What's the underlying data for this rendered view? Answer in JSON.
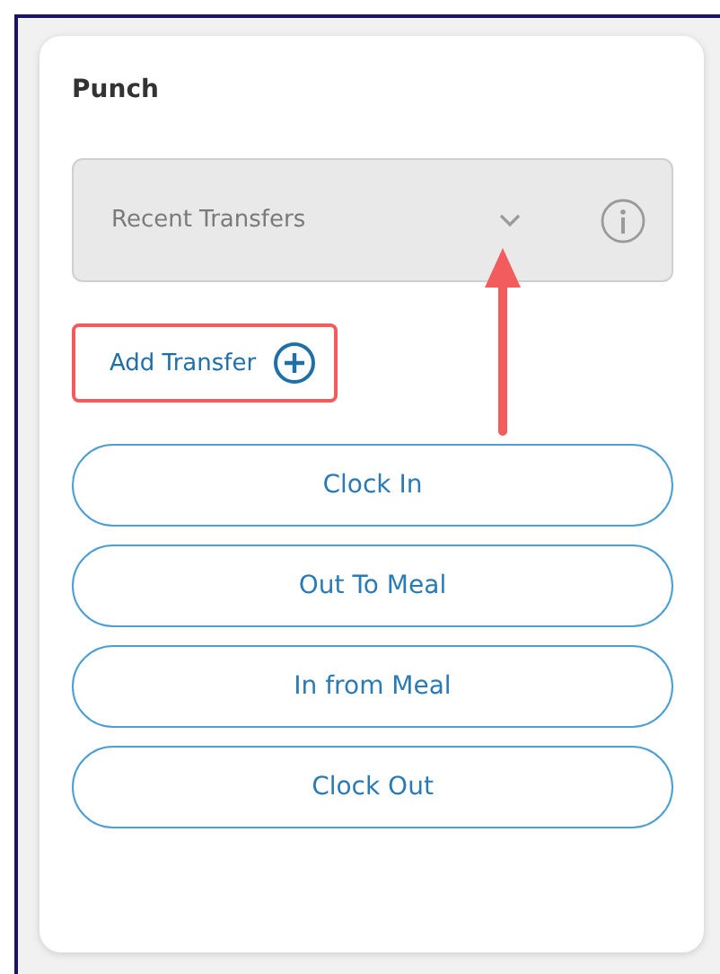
{
  "panel": {
    "title": "Punch"
  },
  "transfer_select": {
    "value": "Recent Transfers"
  },
  "add_transfer": {
    "label": "Add Transfer",
    "highlighted": true
  },
  "punch_buttons": [
    {
      "label": "Clock In"
    },
    {
      "label": "Out To Meal"
    },
    {
      "label": "In from Meal"
    },
    {
      "label": "Clock Out"
    }
  ]
}
